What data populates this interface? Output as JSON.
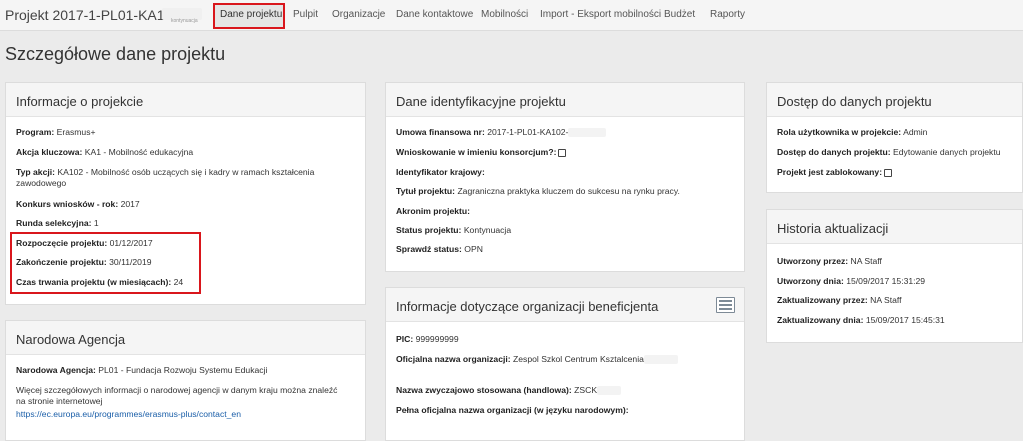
{
  "header": {
    "project_title": "Projekt 2017-1-PL01-KA102-",
    "project_subtitle": "kontynuacja",
    "nav": [
      {
        "label": "Dane projektu",
        "active": true
      },
      {
        "label": "Pulpit"
      },
      {
        "label": "Organizacje"
      },
      {
        "label": "Dane kontaktowe"
      },
      {
        "label": "Mobilności"
      },
      {
        "label": "Import - Eksport mobilności"
      },
      {
        "label": "Budżet"
      },
      {
        "label": "Raporty"
      }
    ]
  },
  "page_title": "Szczegółowe dane projektu",
  "info": {
    "title": "Informacje o projekcie",
    "rows": [
      {
        "label": "Program:",
        "value": "Erasmus+"
      },
      {
        "label": "Akcja kluczowa:",
        "value": "KA1 - Mobilność edukacyjna"
      },
      {
        "label": "Typ akcji:",
        "value": "KA102 - Mobilność osób uczących się i kadry w ramach kształcenia zawodowego"
      },
      {
        "label": "Konkurs wniosków - rok:",
        "value": "2017"
      },
      {
        "label": "Runda selekcyjna:",
        "value": "1"
      },
      {
        "label": "Rozpoczęcie projektu:",
        "value": "01/12/2017"
      },
      {
        "label": "Zakończenie projektu:",
        "value": "30/11/2019"
      },
      {
        "label": "Czas trwania projektu (w miesiącach):",
        "value": "24"
      }
    ]
  },
  "agency": {
    "title": "Narodowa Agencja",
    "label": "Narodowa Agencja:",
    "value": "PL01 - Fundacja Rozwoju Systemu Edukacji",
    "more_text": "Więcej szczegółowych informacji o narodowej agencji w danym kraju można znaleźć na stronie internetowej",
    "link": "https://ec.europa.eu/programmes/erasmus-plus/contact_en"
  },
  "ident": {
    "title": "Dane identyfikacyjne projektu",
    "rows": [
      {
        "label": "Umowa finansowa nr:",
        "value": "2017-1-PL01-KA102-"
      },
      {
        "label": "Wnioskowanie w imieniu konsorcjum?:",
        "value": ""
      },
      {
        "label": "Identyfikator krajowy:",
        "value": ""
      },
      {
        "label": "Tytuł projektu:",
        "value": "Zagraniczna praktyka kluczem do sukcesu na rynku pracy."
      },
      {
        "label": "Akronim projektu:",
        "value": ""
      },
      {
        "label": "Status projektu:",
        "value": "Kontynuacja"
      },
      {
        "label": "Sprawdź status:",
        "value": "OPN"
      }
    ]
  },
  "beneficiary": {
    "title": "Informacje dotyczące organizacji beneficjenta",
    "rows": [
      {
        "label": "PIC:",
        "value": "999999999"
      },
      {
        "label": "Oficjalna nazwa organizacji:",
        "value": "Zespol Szkol Centrum Ksztalcenia"
      },
      {
        "label": "Nazwa zwyczajowo stosowana (handlowa):",
        "value": "ZSCK"
      },
      {
        "label": "Pełna oficjalna nazwa organizacji (w języku narodowym):",
        "value": ""
      }
    ]
  },
  "access": {
    "title": "Dostęp do danych projektu",
    "rows": [
      {
        "label": "Rola użytkownika w projekcie:",
        "value": "Admin"
      },
      {
        "label": "Dostęp do danych projektu:",
        "value": "Edytowanie danych projektu"
      },
      {
        "label": "Projekt jest zablokowany:",
        "value": ""
      }
    ]
  },
  "history": {
    "title": "Historia aktualizacji",
    "rows": [
      {
        "label": "Utworzony przez:",
        "value": "NA Staff"
      },
      {
        "label": "Utworzony dnia:",
        "value": "15/09/2017 15:31:29"
      },
      {
        "label": "Zaktualizowany przez:",
        "value": "NA Staff"
      },
      {
        "label": "Zaktualizowany dnia:",
        "value": "15/09/2017 15:45:31"
      }
    ]
  },
  "colors": {
    "highlight": "#d9161c",
    "link": "#1a5ea8"
  }
}
